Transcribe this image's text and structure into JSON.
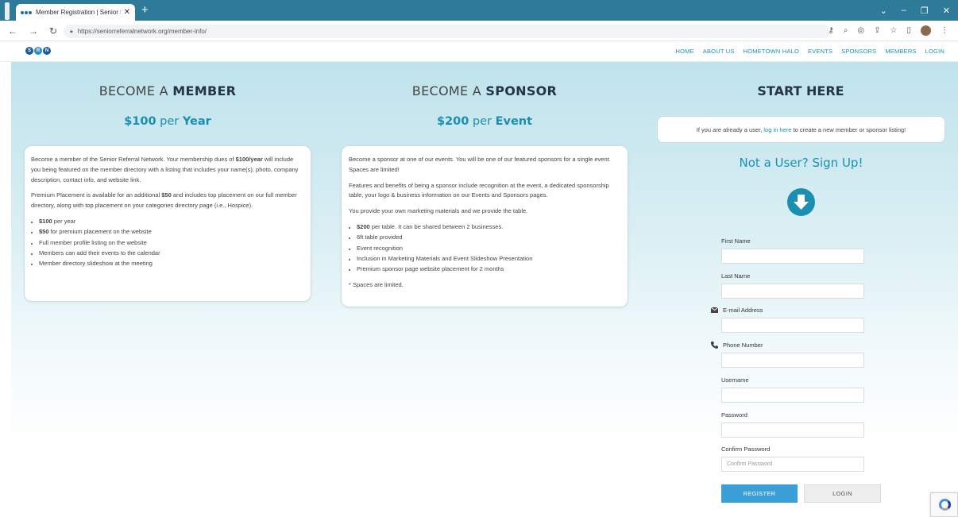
{
  "browser": {
    "tab_title": "Member Registration | Senior R",
    "tab_close": "✕",
    "new_tab": "+",
    "url": "https://seniorreferralnetwork.org/member-info/",
    "window_controls": [
      "⌄",
      "–",
      "❐",
      "✕"
    ]
  },
  "site": {
    "logo_letters": [
      "S",
      "R",
      "N"
    ],
    "nav": [
      "HOME",
      "ABOUT US",
      "HOMETOWN HALO",
      "EVENTS",
      "SPONSORS",
      "MEMBERS",
      "LOGIN"
    ]
  },
  "member": {
    "title_prefix": "BECOME A",
    "title_strong": "MEMBER",
    "price_amount": "$100",
    "price_per": "per",
    "price_unit": "Year",
    "para1_a": "Become a member of the Senior Referral Network. Your membership dues of ",
    "para1_strong": "$100/year",
    "para1_b": " will include you being featured on the member directory with a listing that includes your name(s), photo, company description, contact info, and website link.",
    "para2_a": "Premium Placement is available for an additional ",
    "para2_strong": "$50",
    "para2_b": " and includes top placement on our full member directory, along with top placement on your categories directory page (i.e., Hospice).",
    "bullets": [
      {
        "strong": "$100",
        "text": " per year"
      },
      {
        "strong": "$50",
        "text": " for premium placement on the website"
      },
      {
        "strong": "",
        "text": "Full member profile listing on the website"
      },
      {
        "strong": "",
        "text": "Members can add their events to the calendar"
      },
      {
        "strong": "",
        "text": "Member directory slideshow at the meeting"
      }
    ]
  },
  "sponsor": {
    "title_prefix": "BECOME A",
    "title_strong": "SPONSOR",
    "price_amount": "$200",
    "price_per": "per",
    "price_unit": "Event",
    "para1": "Become a sponsor at one of our events. You will be one of our featured sponsors for a single event. Spaces are limited!",
    "para2": "Features and benefits of being a sponsor include recognition at the event, a dedicated sponsorship table, your logo & business information on our Events and Sponsors pages.",
    "para3": "You provide your own marketing materials and we provide the table.",
    "bullets": [
      {
        "strong": "$200",
        "text": " per table. It can be shared between 2 businesses."
      },
      {
        "strong": "",
        "text": "6ft table provided"
      },
      {
        "strong": "",
        "text": "Event recognition"
      },
      {
        "strong": "",
        "text": "Inclusion in Marketing Materials and Event Slideshow Presentation"
      },
      {
        "strong": "",
        "text": "Premium sponsor page website placement for 2 months"
      }
    ],
    "footnote": "* Spaces are limited."
  },
  "start": {
    "title": "START HERE",
    "note_a": "If you are already a user, ",
    "note_link": "log in here",
    "note_b": " to create a new member or sponsor listing!",
    "signup_title": "Not a User? Sign Up!"
  },
  "form": {
    "first_name_label": "First Name",
    "last_name_label": "Last Name",
    "email_label": "E-mail Address",
    "phone_label": "Phone Number",
    "username_label": "Username",
    "password_label": "Password",
    "confirm_label": "Confirm Password",
    "confirm_placeholder": "Confirm Password",
    "register_label": "REGISTER",
    "login_label": "LOGIN"
  }
}
